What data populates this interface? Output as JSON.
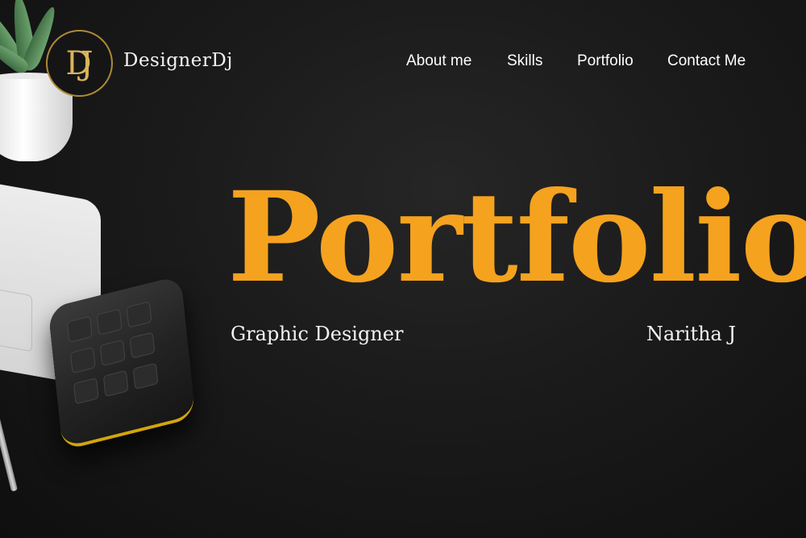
{
  "header": {
    "logo_monogram": "DJ",
    "brand_name": "DesignerDj"
  },
  "nav": {
    "items": [
      {
        "label": "About me"
      },
      {
        "label": "Skills"
      },
      {
        "label": "Portfolio"
      },
      {
        "label": "Contact Me"
      }
    ]
  },
  "hero": {
    "title": "Portfolio",
    "role": "Graphic Designer",
    "name": "Naritha J"
  },
  "colors": {
    "accent": "#f5a21f",
    "background": "#1a1a1a",
    "logo_gold": "#d8b45a"
  }
}
